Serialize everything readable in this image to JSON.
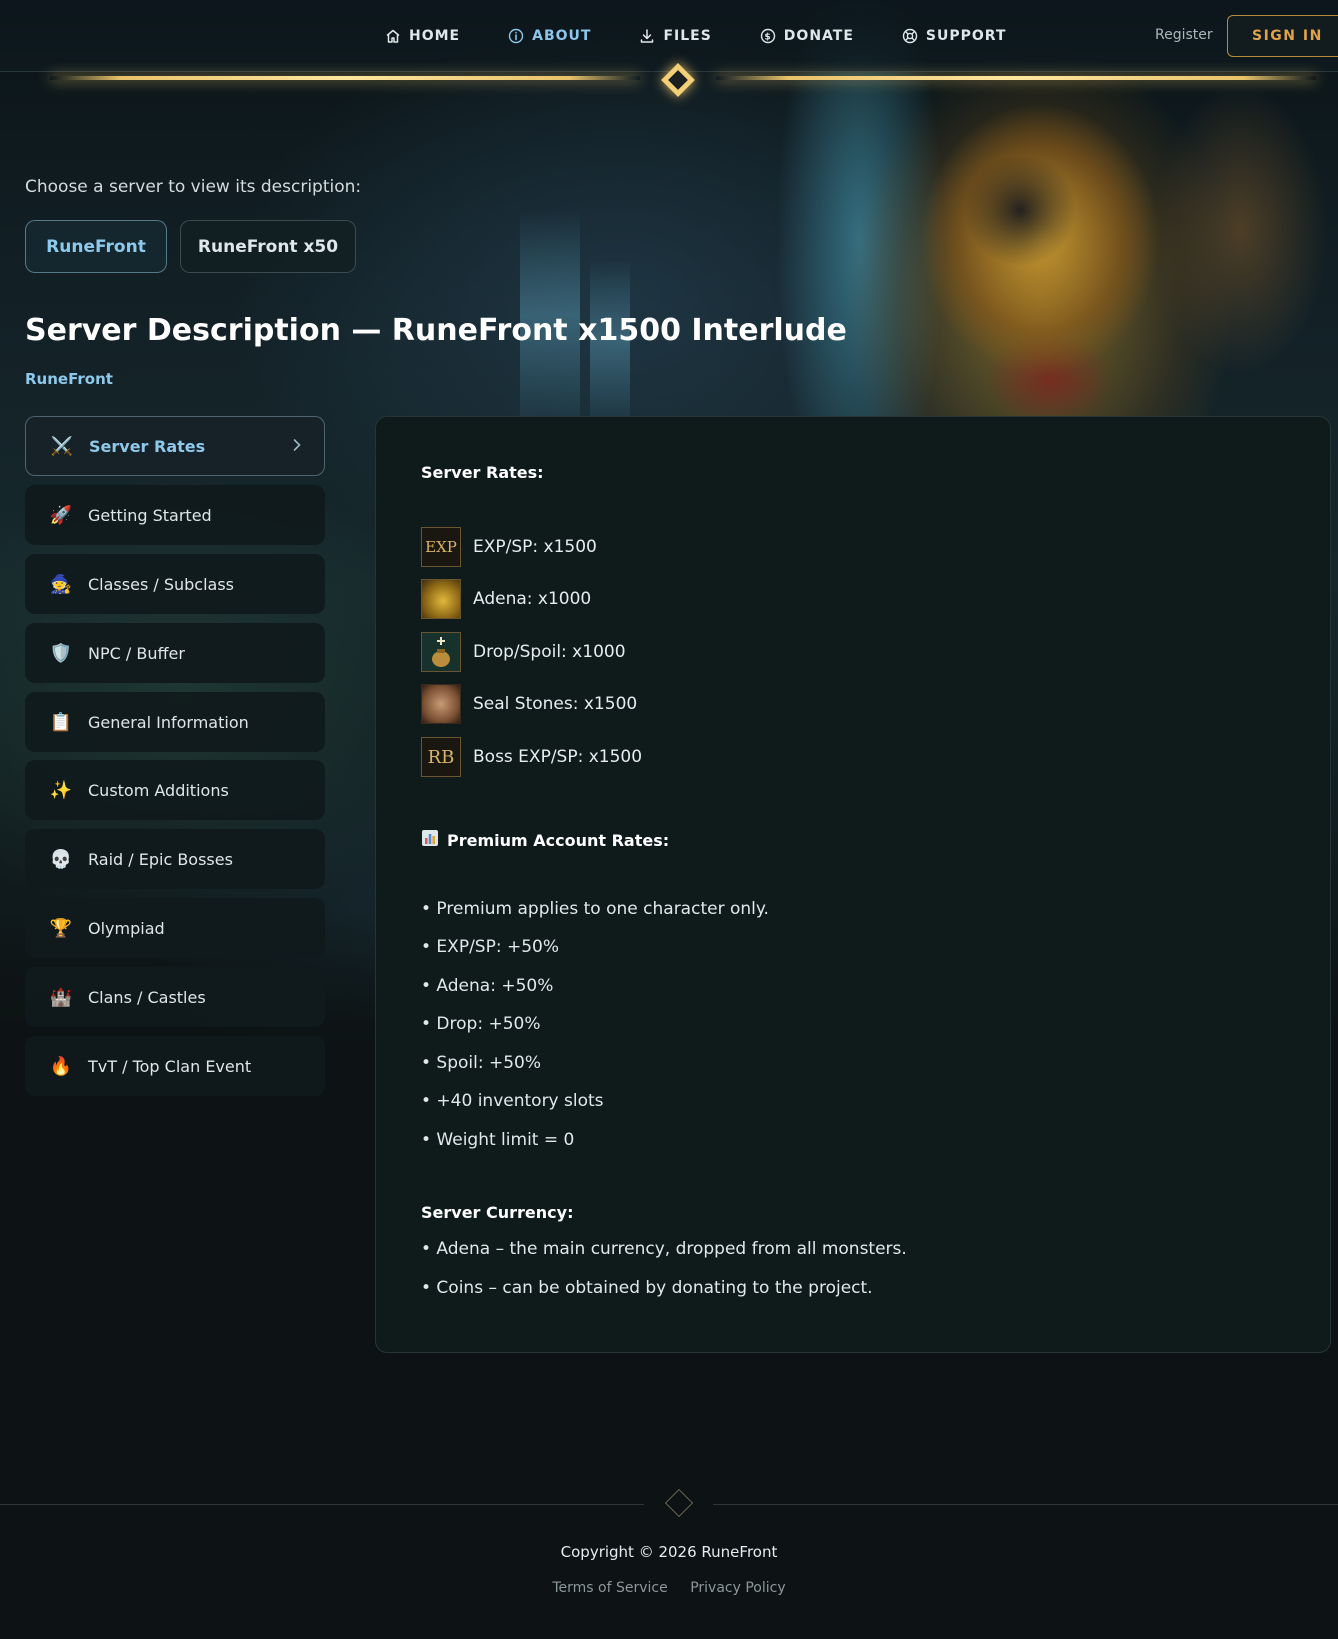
{
  "nav": {
    "items": [
      {
        "label": "HOME",
        "icon": "home-icon"
      },
      {
        "label": "ABOUT",
        "icon": "info-icon"
      },
      {
        "label": "FILES",
        "icon": "download-icon"
      },
      {
        "label": "DONATE",
        "icon": "dollar-icon"
      },
      {
        "label": "SUPPORT",
        "icon": "lifebuoy-icon"
      }
    ],
    "register_label": "Register",
    "signin_label": "SIGN IN"
  },
  "intro": {
    "choose_text": "Choose a server to view its description:",
    "servers": [
      "RuneFront",
      "RuneFront x50"
    ],
    "selected_server": "RuneFront"
  },
  "page": {
    "title": "Server Description — RuneFront x1500 Interlude",
    "breadcrumb": "RuneFront"
  },
  "sidebar": {
    "items": [
      {
        "label": "Server Rates",
        "icon": "crossed-swords-icon",
        "emoji": "⚔️"
      },
      {
        "label": "Getting Started",
        "icon": "rocket-icon",
        "emoji": "🚀"
      },
      {
        "label": "Classes / Subclass",
        "icon": "mage-icon",
        "emoji": "🧙"
      },
      {
        "label": "NPC / Buffer",
        "icon": "shield-icon",
        "emoji": "🛡️"
      },
      {
        "label": "General Information",
        "icon": "clipboard-icon",
        "emoji": "📋"
      },
      {
        "label": "Custom Additions",
        "icon": "sparkles-icon",
        "emoji": "✨"
      },
      {
        "label": "Raid / Epic Bosses",
        "icon": "skull-icon",
        "emoji": "💀"
      },
      {
        "label": "Olympiad",
        "icon": "trophy-icon",
        "emoji": "🏆"
      },
      {
        "label": "Clans / Castles",
        "icon": "castle-icon",
        "emoji": "🏰"
      },
      {
        "label": "TvT / Top Clan Event",
        "icon": "fire-icon",
        "emoji": "🔥"
      }
    ],
    "active": "Server Rates"
  },
  "content": {
    "rates_title": "Server Rates:",
    "rates": [
      {
        "label": "EXP/SP: x1500",
        "icon": "exp-icon",
        "glyph": "EXP"
      },
      {
        "label": "Adena: x1000",
        "icon": "adena-coins-icon",
        "glyph": ""
      },
      {
        "label": "Drop/Spoil: x1000",
        "icon": "drop-bag-icon",
        "glyph": ""
      },
      {
        "label": "Seal Stones: x1500",
        "icon": "seal-stone-icon",
        "glyph": ""
      },
      {
        "label": "Boss EXP/SP: x1500",
        "icon": "raid-boss-icon",
        "glyph": "RB"
      }
    ],
    "premium_title": "Premium Account Rates:",
    "premium_items": [
      "• Premium applies to one character only.",
      "• EXP/SP: +50%",
      "• Adena: +50%",
      "• Drop: +50%",
      "• Spoil: +50%",
      "• +40 inventory slots",
      "• Weight limit = 0"
    ],
    "currency_title": "Server Currency:",
    "currency_items": [
      "• Adena – the main currency, dropped from all monsters.",
      "• Coins – can be obtained by donating to the project."
    ]
  },
  "footer": {
    "copyright": "Copyright © 2026 RuneFront",
    "links": [
      "Terms of Service",
      "Privacy Policy"
    ]
  },
  "colors": {
    "accent_blue": "#8ec9ec",
    "gold": "#e8c26a",
    "panel_bg": "#0f1a1b"
  }
}
